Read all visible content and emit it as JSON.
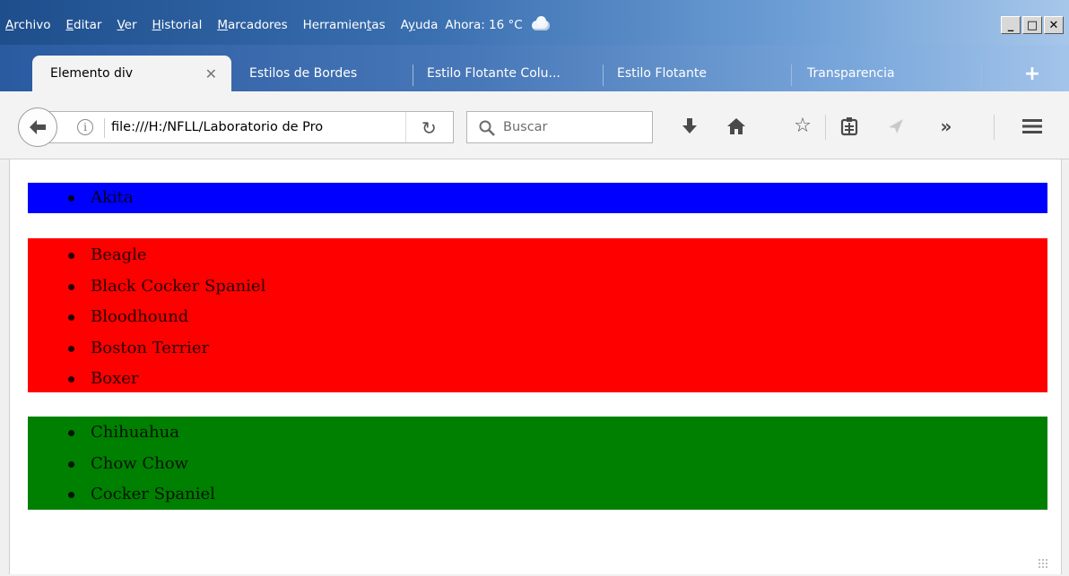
{
  "menu": {
    "items": [
      {
        "pre": "",
        "acc": "A",
        "post": "rchivo"
      },
      {
        "pre": "",
        "acc": "E",
        "post": "ditar"
      },
      {
        "pre": "",
        "acc": "V",
        "post": "er"
      },
      {
        "pre": "",
        "acc": "H",
        "post": "istorial"
      },
      {
        "pre": "",
        "acc": "M",
        "post": "arcadores"
      },
      {
        "pre": "Herramien",
        "acc": "t",
        "post": "as"
      },
      {
        "pre": "A",
        "acc": "y",
        "post": "uda"
      }
    ],
    "weather": "Ahora: 16 °C"
  },
  "window_controls": {
    "minimize": "_",
    "maximize": "□",
    "close": "✕"
  },
  "tabs": {
    "active": {
      "label": "Elemento div",
      "close": "✕"
    },
    "others": [
      "Estilos de Bordes",
      "Estilo Flotante Colu...",
      "Estilo Flotante",
      "Transparencia"
    ],
    "new_tab": "+"
  },
  "toolbar": {
    "back": "back-arrow-icon",
    "url": "file:///H:/NFLL/Laboratorio de Pro",
    "search_placeholder": "Buscar",
    "icons": [
      "download-icon",
      "home-icon",
      "bookmark-star-icon",
      "reading-list-icon",
      "pocket-icon",
      "overflow-chevron-icon",
      "hamburger-menu-icon"
    ]
  },
  "content": {
    "blocks": [
      {
        "color": "#0000ff",
        "items": [
          "Akita"
        ]
      },
      {
        "color": "#ff0000",
        "items": [
          "Beagle",
          "Black Cocker Spaniel",
          "Bloodhound",
          "Boston Terrier",
          "Boxer"
        ]
      },
      {
        "color": "#008000",
        "items": [
          "Chihuahua",
          "Chow Chow",
          "Cocker Spaniel"
        ]
      }
    ]
  }
}
